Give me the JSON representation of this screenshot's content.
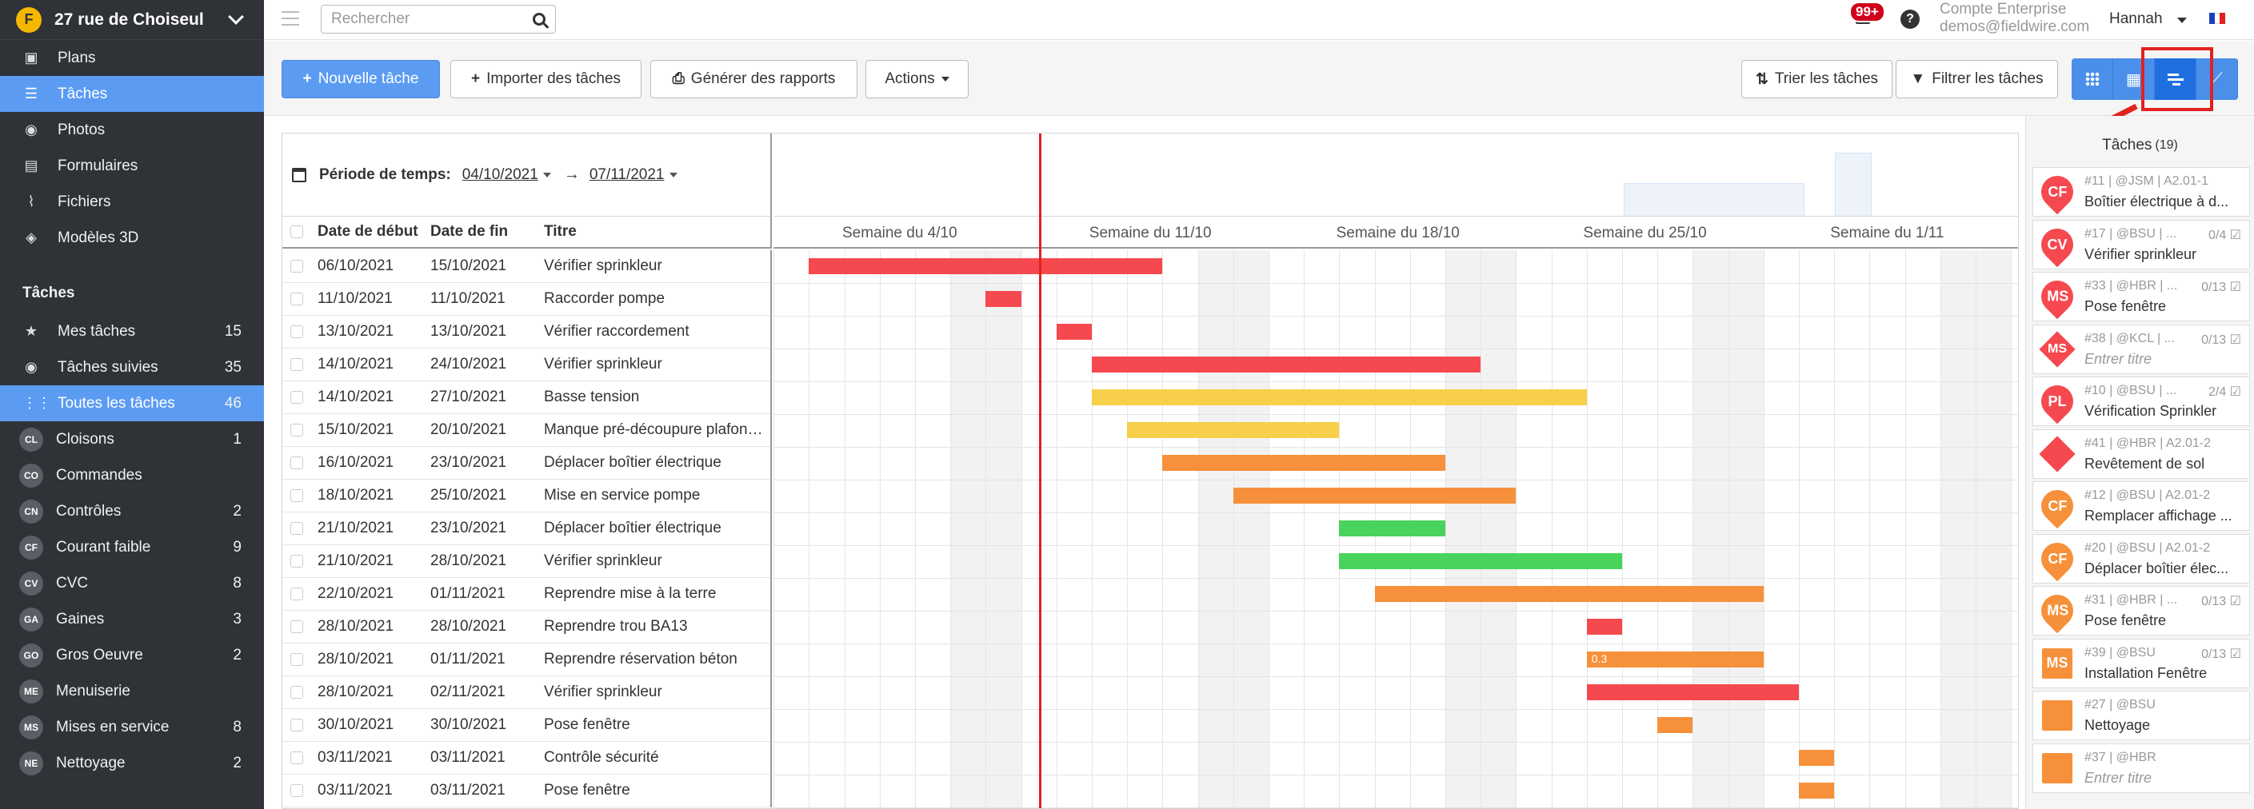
{
  "project": {
    "name": "27 rue de Choiseul",
    "logo_initial": "F"
  },
  "nav": [
    {
      "label": "Plans",
      "icon": "plans-icon",
      "glyph": "▣"
    },
    {
      "label": "Tâches",
      "icon": "tasks-icon",
      "glyph": "☰",
      "active": true
    },
    {
      "label": "Photos",
      "icon": "camera-icon",
      "glyph": "◉"
    },
    {
      "label": "Formulaires",
      "icon": "forms-icon",
      "glyph": "▤"
    },
    {
      "label": "Fichiers",
      "icon": "paperclip-icon",
      "glyph": "⌇"
    },
    {
      "label": "Modèles 3D",
      "icon": "cube-icon",
      "glyph": "◈"
    }
  ],
  "tasks_section": {
    "title": "Tâches",
    "filters": [
      {
        "label": "Mes tâches",
        "count": "15",
        "icon": "star-icon",
        "glyph": "★"
      },
      {
        "label": "Tâches suivies",
        "count": "35",
        "icon": "eye-icon",
        "glyph": "◉"
      },
      {
        "label": "Toutes les tâches",
        "count": "46",
        "icon": "grid-icon",
        "glyph": "⋮⋮",
        "active": true
      }
    ],
    "categories": [
      {
        "code": "CL",
        "label": "Cloisons",
        "count": "1"
      },
      {
        "code": "CO",
        "label": "Commandes",
        "count": ""
      },
      {
        "code": "CN",
        "label": "Contrôles",
        "count": "2"
      },
      {
        "code": "CF",
        "label": "Courant faible",
        "count": "9"
      },
      {
        "code": "CV",
        "label": "CVC",
        "count": "8"
      },
      {
        "code": "GA",
        "label": "Gaines",
        "count": "3"
      },
      {
        "code": "GO",
        "label": "Gros Oeuvre",
        "count": "2"
      },
      {
        "code": "ME",
        "label": "Menuiserie",
        "count": ""
      },
      {
        "code": "MS",
        "label": "Mises en service",
        "count": "8"
      },
      {
        "code": "NE",
        "label": "Nettoyage",
        "count": "2"
      }
    ]
  },
  "topbar": {
    "search_placeholder": "Rechercher",
    "notifications": "99+",
    "help": "?",
    "account_type": "Compte Enterprise",
    "account_email": "demos@fieldwire.com",
    "user": "Hannah"
  },
  "toolbar": {
    "new_task": "Nouvelle tâche",
    "import": "Importer des tâches",
    "reports": "Générer des rapports",
    "actions": "Actions",
    "sort": "Trier les tâches",
    "filter": "Filtrer les tâches"
  },
  "period": {
    "label": "Période de temps:",
    "from": "04/10/2021",
    "to": "07/11/2021"
  },
  "table": {
    "headers": {
      "start": "Date de début",
      "end": "Date de fin",
      "title": "Titre"
    },
    "rows": [
      {
        "start": "06/10/2021",
        "end": "15/10/2021",
        "title": "Vérifier sprinkleur"
      },
      {
        "start": "11/10/2021",
        "end": "11/10/2021",
        "title": "Raccorder pompe"
      },
      {
        "start": "13/10/2021",
        "end": "13/10/2021",
        "title": "Vérifier raccordement"
      },
      {
        "start": "14/10/2021",
        "end": "24/10/2021",
        "title": "Vérifier sprinkleur"
      },
      {
        "start": "14/10/2021",
        "end": "27/10/2021",
        "title": "Basse tension"
      },
      {
        "start": "15/10/2021",
        "end": "20/10/2021",
        "title": "Manque pré-découpure plafonnier"
      },
      {
        "start": "16/10/2021",
        "end": "23/10/2021",
        "title": "Déplacer boîtier électrique"
      },
      {
        "start": "18/10/2021",
        "end": "25/10/2021",
        "title": "Mise en service pompe"
      },
      {
        "start": "21/10/2021",
        "end": "23/10/2021",
        "title": "Déplacer boîtier électrique"
      },
      {
        "start": "21/10/2021",
        "end": "28/10/2021",
        "title": "Vérifier sprinkleur"
      },
      {
        "start": "22/10/2021",
        "end": "01/11/2021",
        "title": "Reprendre mise à la terre"
      },
      {
        "start": "28/10/2021",
        "end": "28/10/2021",
        "title": "Reprendre trou BA13"
      },
      {
        "start": "28/10/2021",
        "end": "01/11/2021",
        "title": "Reprendre réservation béton"
      },
      {
        "start": "28/10/2021",
        "end": "02/11/2021",
        "title": "Vérifier sprinkleur"
      },
      {
        "start": "30/10/2021",
        "end": "30/10/2021",
        "title": "Pose fenêtre"
      },
      {
        "start": "03/11/2021",
        "end": "03/11/2021",
        "title": "Contrôle sécurité"
      },
      {
        "start": "03/11/2021",
        "end": "03/11/2021",
        "title": "Pose fenêtre"
      }
    ]
  },
  "gantt": {
    "weeks": [
      "Semaine du 4/10",
      "Semaine du 11/10",
      "Semaine du 18/10",
      "Semaine du 25/10",
      "Semaine du 1/11"
    ],
    "today_day_offset": 8.5,
    "bars": [
      {
        "start": 2,
        "end": 12,
        "color": "#f5494f"
      },
      {
        "start": 7,
        "end": 8,
        "color": "#f5494f"
      },
      {
        "start": 9,
        "end": 10,
        "color": "#f5494f"
      },
      {
        "start": 10,
        "end": 21,
        "color": "#f5494f"
      },
      {
        "start": 10,
        "end": 24,
        "color": "#f7cf4a"
      },
      {
        "start": 11,
        "end": 17,
        "color": "#f7cf4a"
      },
      {
        "start": 12,
        "end": 20,
        "color": "#f7903a"
      },
      {
        "start": 14,
        "end": 22,
        "color": "#f7903a"
      },
      {
        "start": 17,
        "end": 20,
        "color": "#48d35c"
      },
      {
        "start": 17,
        "end": 25,
        "color": "#48d35c"
      },
      {
        "start": 18,
        "end": 29,
        "color": "#f7903a"
      },
      {
        "start": 24,
        "end": 25,
        "color": "#f5494f"
      },
      {
        "start": 24,
        "end": 29,
        "color": "#f7903a",
        "label": "0.3"
      },
      {
        "start": 24,
        "end": 30,
        "color": "#f5494f"
      },
      {
        "start": 26,
        "end": 27,
        "color": "#f7903a"
      },
      {
        "start": 30,
        "end": 31,
        "color": "#f7903a"
      },
      {
        "start": 30,
        "end": 31,
        "color": "#f7903a"
      }
    ]
  },
  "right_panel": {
    "title": "Tâches",
    "count": "(19)",
    "cards": [
      {
        "initials": "CF",
        "shape": "round",
        "color": "#f5494f",
        "meta": "#11 | @JSM | A2.01-1",
        "progress": "",
        "title": "Boîtier électrique à d..."
      },
      {
        "initials": "CV",
        "shape": "round",
        "color": "#f5494f",
        "meta": "#17 | @BSU | ...",
        "progress": "0/4 ☑",
        "title": "Vérifier sprinkleur"
      },
      {
        "initials": "MS",
        "shape": "round",
        "color": "#f5494f",
        "meta": "#33 | @HBR | ...",
        "progress": "0/13 ☑",
        "title": "Pose fenêtre"
      },
      {
        "initials": "MS",
        "shape": "diamond",
        "color": "#f5494f",
        "meta": "#38 | @KCL | ...",
        "progress": "0/13 ☑",
        "title": "Entrer titre",
        "empty": true
      },
      {
        "initials": "PL",
        "shape": "round",
        "color": "#f5494f",
        "meta": "#10 | @BSU | ...",
        "progress": "2/4 ☑",
        "title": "Vérification Sprinkler"
      },
      {
        "initials": "",
        "shape": "diamond",
        "color": "#f5494f",
        "meta": "#41 | @HBR | A2.01-2",
        "progress": "",
        "title": "Revêtement de sol"
      },
      {
        "initials": "CF",
        "shape": "round",
        "color": "#f7903a",
        "meta": "#12 | @BSU | A2.01-2",
        "progress": "",
        "title": "Remplacer affichage ..."
      },
      {
        "initials": "CF",
        "shape": "round",
        "color": "#f7903a",
        "meta": "#20 | @BSU | A2.01-2",
        "progress": "",
        "title": "Déplacer boîtier élec..."
      },
      {
        "initials": "MS",
        "shape": "round",
        "color": "#f7903a",
        "meta": "#31 | @HBR | ...",
        "progress": "0/13 ☑",
        "title": "Pose fenêtre"
      },
      {
        "initials": "MS",
        "shape": "square",
        "color": "#f7903a",
        "meta": "#39 | @BSU",
        "progress": "0/13 ☑",
        "title": "Installation Fenêtre"
      },
      {
        "initials": "",
        "shape": "square",
        "color": "#f7903a",
        "meta": "#27 | @BSU",
        "progress": "",
        "title": "Nettoyage"
      },
      {
        "initials": "",
        "shape": "square",
        "color": "#f7903a",
        "meta": "#37 | @HBR",
        "progress": "",
        "title": "Entrer titre",
        "empty": true
      }
    ]
  },
  "colors": {
    "accent": "#5b9cf2",
    "sidebar_bg": "#2f3237",
    "today_line": "#e3211f",
    "highlight": "#e3211f"
  }
}
